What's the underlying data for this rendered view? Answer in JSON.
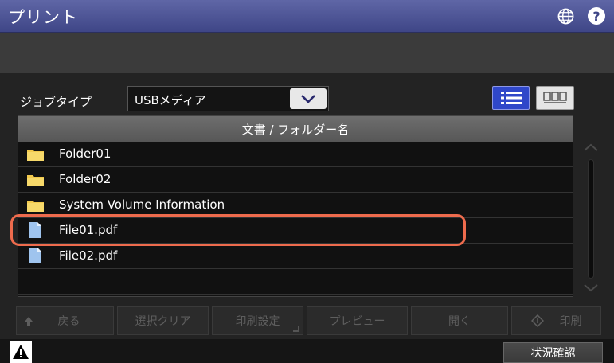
{
  "title": "プリント",
  "icons": {
    "globe": "globe-icon",
    "help": "help-icon",
    "help_glyph": "?",
    "dropdown": "chevron-down-icon",
    "list_view": "list-view-icon",
    "thumbnail_view": "thumbnail-view-icon",
    "folder": "folder-icon",
    "file": "file-icon",
    "warning": "warning-icon"
  },
  "colors": {
    "title_bar": "#4b528f",
    "accent_blue": "#2f47c9",
    "highlight": "#ee6b4d",
    "folder": "#f2c94c"
  },
  "job_type": {
    "label": "ジョブタイプ",
    "selected": "USBメディア"
  },
  "file_list": {
    "header": "文書 / フォルダー名",
    "items": [
      {
        "type": "folder",
        "name": "Folder01"
      },
      {
        "type": "folder",
        "name": "Folder02"
      },
      {
        "type": "folder",
        "name": "System Volume Information"
      },
      {
        "type": "file",
        "name": "File01.pdf",
        "highlighted": true
      },
      {
        "type": "file",
        "name": "File02.pdf"
      }
    ]
  },
  "actions": {
    "back": "戻る",
    "clear_selection": "選択クリア",
    "print_settings": "印刷設定",
    "preview": "プレビュー",
    "open": "開く",
    "print": "印刷"
  },
  "status": {
    "status_check": "状況確認"
  }
}
